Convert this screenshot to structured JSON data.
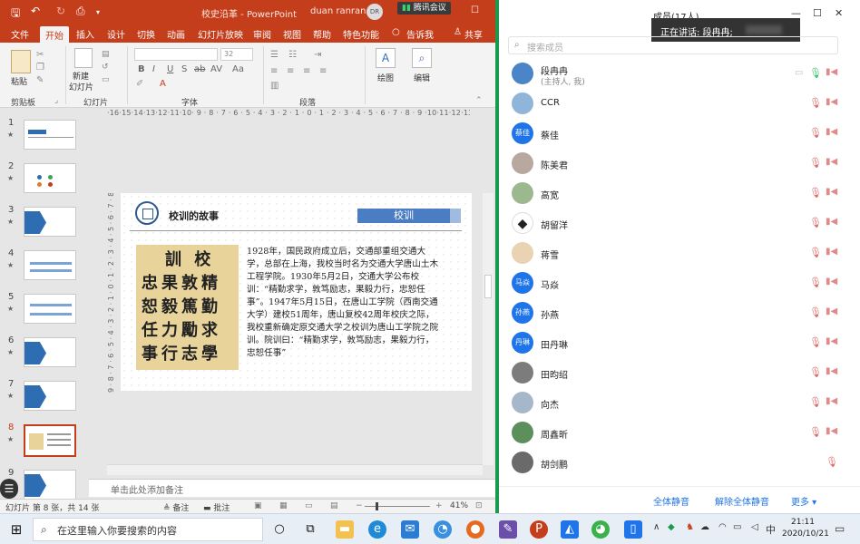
{
  "powerpoint": {
    "title_bar": {
      "quick_access": [
        "🖫",
        "↶",
        "↻",
        "⎙",
        "▾"
      ],
      "doc_title": "校史沿革 - PowerPoint",
      "user_name": "duan ranran",
      "user_initials": "DR",
      "meeting_badge": "腾讯会议",
      "window_controls": [
        "—",
        "☐",
        "✕"
      ]
    },
    "tabs": [
      "文件",
      "开始",
      "插入",
      "设计",
      "切换",
      "动画",
      "幻灯片放映",
      "审阅",
      "视图",
      "帮助",
      "特色功能",
      "告诉我",
      "共享"
    ],
    "active_tab": "开始",
    "ribbon": {
      "paste": "粘贴",
      "new_slide_line1": "新建",
      "new_slide_line2": "幻灯片",
      "draw": "绘图",
      "edit": "编辑",
      "font_size": "32",
      "group_clipboard": "剪贴板",
      "group_slides": "幻灯片",
      "group_font": "字体",
      "group_paragraph": "段落",
      "font_buttons": [
        "B",
        "I",
        "U",
        "S",
        "ab",
        "AV",
        "Aa",
        "A"
      ]
    },
    "thumbnails": [
      {
        "num": "1",
        "star": "★"
      },
      {
        "num": "2",
        "star": "★"
      },
      {
        "num": "3",
        "star": "★"
      },
      {
        "num": "4",
        "star": "★"
      },
      {
        "num": "5",
        "star": "★"
      },
      {
        "num": "6",
        "star": "★"
      },
      {
        "num": "7",
        "star": "★"
      },
      {
        "num": "8",
        "star": "★"
      },
      {
        "num": "9",
        "star": "★"
      }
    ],
    "ruler_h": "·16·15·14·13·12·11·10· 9 · 8 · 7 · 6 · 5 · 4 · 3 · 2 · 1 · 0 · 1 · 2 · 3 · 4 · 5 · 6 · 7 · 8 · 9 ·10·11·12·13·14·15·16·",
    "ruler_v": "9 · 8 · 7 · 6 · 5 · 4 · 3 · 2 · 1 · 0 · 1 · 2 · 3 · 4 · 5 · 6 · 7 · 8 · 9",
    "slide": {
      "heading": "校训的故事",
      "tag": "校训",
      "calligraphy": [
        "訓 校",
        "忠果敦精",
        "恕毅篤勤",
        "任力勵求",
        "事行志學"
      ],
      "body": "1928年，国民政府成立后，交通部重组交通大学，总部在上海，我校当时名为交通大学唐山土木工程学院。1930年5月2日，交通大学公布校训：“精勤求学，敦笃励志，果毅力行，忠恕任事”。1947年5月15日，在唐山工学院（西南交通大学）建校51周年，唐山复校42周年校庆之际，我校重新确定原交通大学之校训为唐山工学院之院训。院训曰：“精勤求学，敦笃励志，果毅力行，忠恕任事”"
    },
    "notes_placeholder": "单击此处添加备注",
    "status": {
      "slide_count": "幻灯片 第 8 张，共 14 张",
      "notes_btn": "≜ 备注",
      "comments_btn": "▬ 批注",
      "zoom": "41%"
    }
  },
  "meeting": {
    "title": "成员(17人)",
    "speaking_label": "正在讲话: 段冉冉;",
    "search_placeholder": "搜索成员",
    "members": [
      {
        "name": "段冉冉",
        "sub": "(主持人, 我)",
        "avatar": "",
        "mic": "🎙",
        "cam": "▮◀"
      },
      {
        "name": "CCR",
        "sub": "",
        "avatar": "",
        "mic": "🎙",
        "cam": "▮◀"
      },
      {
        "name": "蔡佳",
        "sub": "",
        "avatar": "蔡佳",
        "mic": "🎙",
        "cam": "▮◀"
      },
      {
        "name": "陈美君",
        "sub": "",
        "avatar": "",
        "mic": "🎙",
        "cam": "▮◀"
      },
      {
        "name": "高宽",
        "sub": "",
        "avatar": "",
        "mic": "🎙",
        "cam": "▮◀"
      },
      {
        "name": "胡留洋",
        "sub": "",
        "avatar": "",
        "mic": "🎙",
        "cam": "▮◀"
      },
      {
        "name": "蒋雪",
        "sub": "",
        "avatar": "",
        "mic": "🎙",
        "cam": "▮◀"
      },
      {
        "name": "马焱",
        "sub": "",
        "avatar": "马焱",
        "mic": "🎙",
        "cam": "▮◀"
      },
      {
        "name": "孙燕",
        "sub": "",
        "avatar": "孙燕",
        "mic": "🎙",
        "cam": "▮◀"
      },
      {
        "name": "田丹琳",
        "sub": "",
        "avatar": "丹琳",
        "mic": "🎙",
        "cam": "▮◀"
      },
      {
        "name": "田昀绍",
        "sub": "",
        "avatar": "",
        "mic": "🎙",
        "cam": "▮◀"
      },
      {
        "name": "向杰",
        "sub": "",
        "avatar": "",
        "mic": "🎙",
        "cam": "▮◀"
      },
      {
        "name": "周鑫昕",
        "sub": "",
        "avatar": "",
        "mic": "🎙",
        "cam": "▮◀"
      },
      {
        "name": "胡剑鹏",
        "sub": "",
        "avatar": "",
        "mic": "🎙",
        "cam": ""
      }
    ],
    "footer": {
      "mute_all": "全体静音",
      "unmute_all": "解除全体静音",
      "more": "更多 ▾"
    }
  },
  "taskbar": {
    "start_icon": "⊞",
    "search_placeholder": "在这里输入你要搜索的内容",
    "ime": "中",
    "time": "21:11",
    "date": "2020/10/21",
    "notification_icon": "▭"
  },
  "colors": {
    "ppt_accent": "#c43e1c",
    "meeting_border": "#1a9a4f",
    "link_blue": "#1e74e8",
    "slide_blue": "#2f6db3"
  }
}
